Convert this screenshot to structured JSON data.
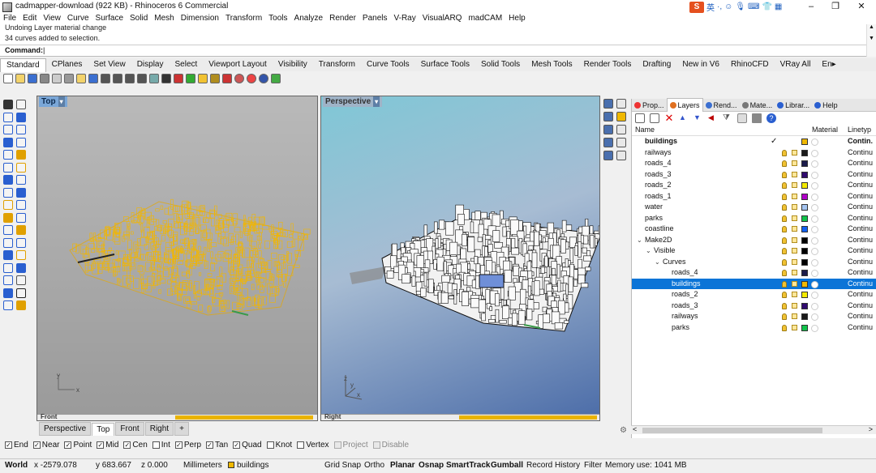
{
  "window": {
    "title": "cadmapper-download (922 KB) - Rhinoceros 6 Commercial",
    "controls": [
      "–",
      "❐",
      "✕"
    ]
  },
  "ime": {
    "logo": "S",
    "lang": "英"
  },
  "menu": [
    "File",
    "Edit",
    "View",
    "Curve",
    "Surface",
    "Solid",
    "Mesh",
    "Dimension",
    "Transform",
    "Tools",
    "Analyze",
    "Render",
    "Panels",
    "V-Ray",
    "VisualARQ",
    "madCAM",
    "Help"
  ],
  "command": {
    "history": [
      "Undoing Layer material change",
      "34 curves added to selection."
    ],
    "prompt": "Command:"
  },
  "tool_tabs": [
    "Standard",
    "CPlanes",
    "Set View",
    "Display",
    "Select",
    "Viewport Layout",
    "Visibility",
    "Transform",
    "Curve Tools",
    "Surface Tools",
    "Solid Tools",
    "Mesh Tools",
    "Render Tools",
    "Drafting",
    "New in V6",
    "RhinoCFD",
    "VRay All",
    "En▸"
  ],
  "toolbar_icons": [
    "new-icon",
    "open-icon",
    "save-icon",
    "print-icon",
    "copy-icon",
    "cut-icon",
    "paste-icon",
    "undo-icon",
    "pan-icon",
    "zoom-icon",
    "zoom-window-icon",
    "zoom-extents-icon",
    "grid-icon",
    "select-icon",
    "point-icon",
    "curve-icon",
    "light-icon",
    "lock-icon",
    "material-icon",
    "render-icon",
    "sphere-icon",
    "globe-icon",
    "options-icon"
  ],
  "viewports": {
    "top": {
      "label": "Top",
      "axis_y": "y",
      "axis_x": "x"
    },
    "perspective": {
      "label": "Perspective",
      "axis_z": "z",
      "axis_y": "y",
      "axis_x": "x"
    },
    "bottom_left": "Front",
    "bottom_right": "Right"
  },
  "viewport_tabs": [
    "Perspective",
    "Top",
    "Front",
    "Right",
    "+"
  ],
  "panel": {
    "tabs": [
      "Prop...",
      "Layers",
      "Rend...",
      "Mate...",
      "Librar...",
      "Help"
    ],
    "headers": {
      "name": "Name",
      "material": "Material",
      "linetype": "Linetyp"
    },
    "layers": [
      {
        "name": "buildings",
        "indent": 0,
        "bold": true,
        "current": true,
        "color": "#f0b800",
        "linetype": "Contin."
      },
      {
        "name": "railways",
        "indent": 0,
        "color": "#1a1a1a",
        "linetype": "Continu"
      },
      {
        "name": "roads_4",
        "indent": 0,
        "color": "#1b1b4a",
        "linetype": "Continu"
      },
      {
        "name": "roads_3",
        "indent": 0,
        "color": "#300a6e",
        "linetype": "Continu"
      },
      {
        "name": "roads_2",
        "indent": 0,
        "color": "#f4ea00",
        "linetype": "Continu"
      },
      {
        "name": "roads_1",
        "indent": 0,
        "color": "#b000c8",
        "linetype": "Continu"
      },
      {
        "name": "water",
        "indent": 0,
        "color": "#a4c4f0",
        "linetype": "Continu"
      },
      {
        "name": "parks",
        "indent": 0,
        "color": "#12c34a",
        "linetype": "Continu"
      },
      {
        "name": "coastline",
        "indent": 0,
        "color": "#1060f0",
        "linetype": "Continu"
      },
      {
        "name": "Make2D",
        "indent": 0,
        "expanded": true,
        "color": "#000000",
        "linetype": "Continu"
      },
      {
        "name": "Visible",
        "indent": 1,
        "expanded": true,
        "color": "#000000",
        "linetype": "Continu"
      },
      {
        "name": "Curves",
        "indent": 2,
        "expanded": true,
        "color": "#000000",
        "linetype": "Continu"
      },
      {
        "name": "roads_4",
        "indent": 3,
        "color": "#1b1b4a",
        "linetype": "Continu"
      },
      {
        "name": "buildings",
        "indent": 3,
        "selected": true,
        "color": "#f0b800",
        "linetype": "Continu"
      },
      {
        "name": "roads_2",
        "indent": 3,
        "color": "#f4ea00",
        "linetype": "Continu"
      },
      {
        "name": "roads_3",
        "indent": 3,
        "color": "#300a6e",
        "linetype": "Continu"
      },
      {
        "name": "railways",
        "indent": 3,
        "color": "#1a1a1a",
        "linetype": "Continu"
      },
      {
        "name": "parks",
        "indent": 3,
        "color": "#12c34a",
        "linetype": "Continu"
      }
    ]
  },
  "osnaps": [
    {
      "label": "End",
      "checked": true
    },
    {
      "label": "Near",
      "checked": true
    },
    {
      "label": "Point",
      "checked": true
    },
    {
      "label": "Mid",
      "checked": true
    },
    {
      "label": "Cen",
      "checked": true
    },
    {
      "label": "Int",
      "checked": false
    },
    {
      "label": "Perp",
      "checked": true
    },
    {
      "label": "Tan",
      "checked": true
    },
    {
      "label": "Quad",
      "checked": true
    },
    {
      "label": "Knot",
      "checked": false
    },
    {
      "label": "Vertex",
      "checked": false
    },
    {
      "label": "Project",
      "checked": false,
      "disabled": true
    },
    {
      "label": "Disable",
      "checked": false,
      "disabled": true
    }
  ],
  "status": {
    "cplane": "World",
    "x": "x -2579.078",
    "y": "y 683.667",
    "z": "z 0.000",
    "units": "Millimeters",
    "layer": "buildings",
    "layer_color": "#f0b800",
    "grid_snap": "Grid Snap",
    "ortho": "Ortho",
    "planar": "Planar",
    "osnap": "Osnap",
    "smarttrack": "SmartTrack",
    "gumball": "Gumball",
    "record_history": "Record History",
    "filter": "Filter",
    "memory": "Memory use: 1041 MB"
  },
  "colors": {
    "city_wire": "#f2b600",
    "accent_blue": "#0b74d7"
  }
}
